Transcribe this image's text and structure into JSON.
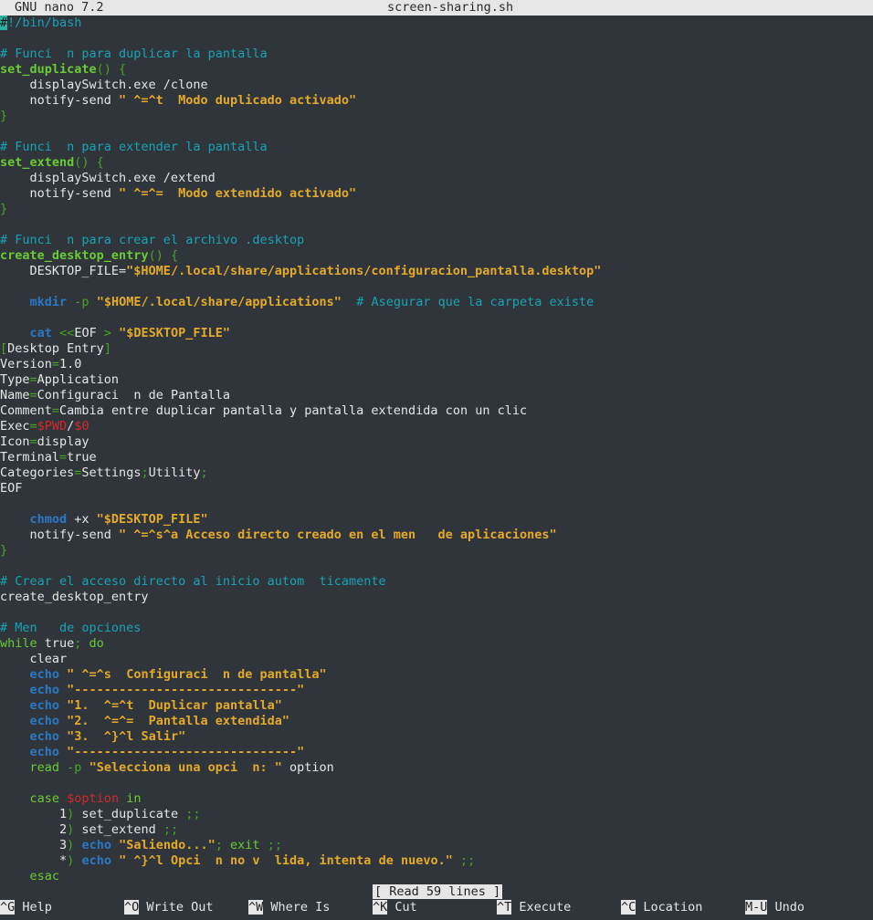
{
  "title_bar": {
    "app": "GNU nano 7.2",
    "filename": "screen-sharing.sh"
  },
  "editor_lines": [
    [
      [
        "cursor",
        "#"
      ],
      [
        "comment",
        "!/bin/bash"
      ]
    ],
    [],
    [
      [
        "comment",
        "# Funci  n para duplicar la pantalla"
      ]
    ],
    [
      [
        "func",
        "set_duplicate"
      ],
      [
        "brace",
        "() {"
      ]
    ],
    [
      [
        "default",
        "    displaySwitch.exe /clone"
      ]
    ],
    [
      [
        "default",
        "    notify-send "
      ],
      [
        "string",
        "\" ^=^t  Modo duplicado activado\""
      ]
    ],
    [
      [
        "brace",
        "}"
      ]
    ],
    [],
    [
      [
        "comment",
        "# Funci  n para extender la pantalla"
      ]
    ],
    [
      [
        "func",
        "set_extend"
      ],
      [
        "brace",
        "() {"
      ]
    ],
    [
      [
        "default",
        "    displaySwitch.exe /extend"
      ]
    ],
    [
      [
        "default",
        "    notify-send "
      ],
      [
        "string",
        "\" ^=^=  Modo extendido activado\""
      ]
    ],
    [
      [
        "brace",
        "}"
      ]
    ],
    [],
    [
      [
        "comment",
        "# Funci  n para crear el archivo .desktop"
      ]
    ],
    [
      [
        "func",
        "create_desktop_entry"
      ],
      [
        "brace",
        "() {"
      ]
    ],
    [
      [
        "default",
        "    DESKTOP_FILE="
      ],
      [
        "string",
        "\"$HOME/.local/share/applications/configuracion_pantalla.desktop\""
      ]
    ],
    [],
    [
      [
        "default",
        "    "
      ],
      [
        "keyword",
        "mkdir"
      ],
      [
        "default",
        " "
      ],
      [
        "muted",
        "-p"
      ],
      [
        "default",
        " "
      ],
      [
        "string",
        "\"$HOME/.local/share/applications\""
      ],
      [
        "default",
        "  "
      ],
      [
        "comment",
        "# Asegurar que la carpeta existe"
      ]
    ],
    [],
    [
      [
        "default",
        "    "
      ],
      [
        "keyword",
        "cat"
      ],
      [
        "default",
        " "
      ],
      [
        "muted",
        "<<"
      ],
      [
        "default",
        "EOF "
      ],
      [
        "muted",
        ">"
      ],
      [
        "default",
        " "
      ],
      [
        "string",
        "\"$DESKTOP_FILE\""
      ]
    ],
    [
      [
        "muted",
        "["
      ],
      [
        "section",
        "Desktop Entry"
      ],
      [
        "muted",
        "]"
      ]
    ],
    [
      [
        "default",
        "Version"
      ],
      [
        "muted",
        "="
      ],
      [
        "default",
        "1.0"
      ]
    ],
    [
      [
        "default",
        "Type"
      ],
      [
        "muted",
        "="
      ],
      [
        "default",
        "Application"
      ]
    ],
    [
      [
        "default",
        "Name"
      ],
      [
        "muted",
        "="
      ],
      [
        "default",
        "Configuraci  n de Pantalla"
      ]
    ],
    [
      [
        "default",
        "Comment"
      ],
      [
        "muted",
        "="
      ],
      [
        "default",
        "Cambia entre duplicar pantalla y pantalla extendida con un clic"
      ]
    ],
    [
      [
        "default",
        "Exec"
      ],
      [
        "muted",
        "="
      ],
      [
        "variable",
        "$PWD"
      ],
      [
        "default",
        "/"
      ],
      [
        "variable",
        "$0"
      ]
    ],
    [
      [
        "default",
        "Icon"
      ],
      [
        "muted",
        "="
      ],
      [
        "default",
        "display"
      ]
    ],
    [
      [
        "default",
        "Terminal"
      ],
      [
        "muted",
        "="
      ],
      [
        "default",
        "true"
      ]
    ],
    [
      [
        "default",
        "Categories"
      ],
      [
        "muted",
        "="
      ],
      [
        "default",
        "Settings"
      ],
      [
        "muted",
        ";"
      ],
      [
        "default",
        "Utility"
      ],
      [
        "muted",
        ";"
      ]
    ],
    [
      [
        "default",
        "EOF"
      ]
    ],
    [],
    [
      [
        "default",
        "    "
      ],
      [
        "keyword",
        "chmod"
      ],
      [
        "default",
        " +x "
      ],
      [
        "string",
        "\"$DESKTOP_FILE\""
      ]
    ],
    [
      [
        "default",
        "    notify-send "
      ],
      [
        "string",
        "\" ^=^s^a Acceso directo creado en el men   de aplicaciones\""
      ]
    ],
    [
      [
        "brace",
        "}"
      ]
    ],
    [],
    [
      [
        "comment",
        "# Crear el acceso directo al inicio autom  ticamente"
      ]
    ],
    [
      [
        "default",
        "create_desktop_entry"
      ]
    ],
    [],
    [
      [
        "comment",
        "# Men   de opciones"
      ]
    ],
    [
      [
        "flow",
        "while"
      ],
      [
        "default",
        " true"
      ],
      [
        "muted",
        "; "
      ],
      [
        "flow",
        "do"
      ]
    ],
    [
      [
        "default",
        "    clear"
      ]
    ],
    [
      [
        "default",
        "    "
      ],
      [
        "keyword",
        "echo"
      ],
      [
        "default",
        " "
      ],
      [
        "string",
        "\" ^=^s  Configuraci  n de pantalla\""
      ]
    ],
    [
      [
        "default",
        "    "
      ],
      [
        "keyword",
        "echo"
      ],
      [
        "default",
        " "
      ],
      [
        "string",
        "\"------------------------------\""
      ]
    ],
    [
      [
        "default",
        "    "
      ],
      [
        "keyword",
        "echo"
      ],
      [
        "default",
        " "
      ],
      [
        "string",
        "\"1.  ^=^t  Duplicar pantalla\""
      ]
    ],
    [
      [
        "default",
        "    "
      ],
      [
        "keyword",
        "echo"
      ],
      [
        "default",
        " "
      ],
      [
        "string",
        "\"2.  ^=^=  Pantalla extendida\""
      ]
    ],
    [
      [
        "default",
        "    "
      ],
      [
        "keyword",
        "echo"
      ],
      [
        "default",
        " "
      ],
      [
        "string",
        "\"3.  ^}^l Salir\""
      ]
    ],
    [
      [
        "default",
        "    "
      ],
      [
        "keyword",
        "echo"
      ],
      [
        "default",
        " "
      ],
      [
        "string",
        "\"------------------------------\""
      ]
    ],
    [
      [
        "default",
        "    "
      ],
      [
        "flow",
        "read"
      ],
      [
        "default",
        " "
      ],
      [
        "muted",
        "-p"
      ],
      [
        "default",
        " "
      ],
      [
        "string",
        "\"Selecciona una opci  n: \""
      ],
      [
        "default",
        " option"
      ]
    ],
    [],
    [
      [
        "default",
        "    "
      ],
      [
        "flow",
        "case"
      ],
      [
        "default",
        " "
      ],
      [
        "variable",
        "$option"
      ],
      [
        "default",
        " "
      ],
      [
        "flow",
        "in"
      ]
    ],
    [
      [
        "default",
        "        1"
      ],
      [
        "muted",
        ")"
      ],
      [
        "default",
        " set_duplicate "
      ],
      [
        "muted",
        ";;"
      ]
    ],
    [
      [
        "default",
        "        2"
      ],
      [
        "muted",
        ")"
      ],
      [
        "default",
        " set_extend "
      ],
      [
        "muted",
        ";;"
      ]
    ],
    [
      [
        "default",
        "        3"
      ],
      [
        "muted",
        ")"
      ],
      [
        "default",
        " "
      ],
      [
        "keyword",
        "echo"
      ],
      [
        "default",
        " "
      ],
      [
        "string",
        "\"Saliendo...\""
      ],
      [
        "muted",
        "; "
      ],
      [
        "flow",
        "exit"
      ],
      [
        "default",
        " "
      ],
      [
        "muted",
        ";;"
      ]
    ],
    [
      [
        "default",
        "        *"
      ],
      [
        "muted",
        ")"
      ],
      [
        "default",
        " "
      ],
      [
        "keyword",
        "echo"
      ],
      [
        "default",
        " "
      ],
      [
        "string",
        "\" ^}^l Opci  n no v  lida, intenta de nuevo.\""
      ],
      [
        "default",
        " "
      ],
      [
        "muted",
        ";;"
      ]
    ],
    [
      [
        "default",
        "    "
      ],
      [
        "flow",
        "esac"
      ]
    ]
  ],
  "status": {
    "message": "[ Read 59 lines ]"
  },
  "shortcuts": [
    {
      "key": "^G",
      "label": "Help"
    },
    {
      "key": "^O",
      "label": "Write Out"
    },
    {
      "key": "^W",
      "label": "Where Is"
    },
    {
      "key": "^K",
      "label": "Cut"
    },
    {
      "key": "^T",
      "label": "Execute"
    },
    {
      "key": "^C",
      "label": "Location"
    },
    {
      "key": "M-U",
      "label": "Undo"
    }
  ]
}
